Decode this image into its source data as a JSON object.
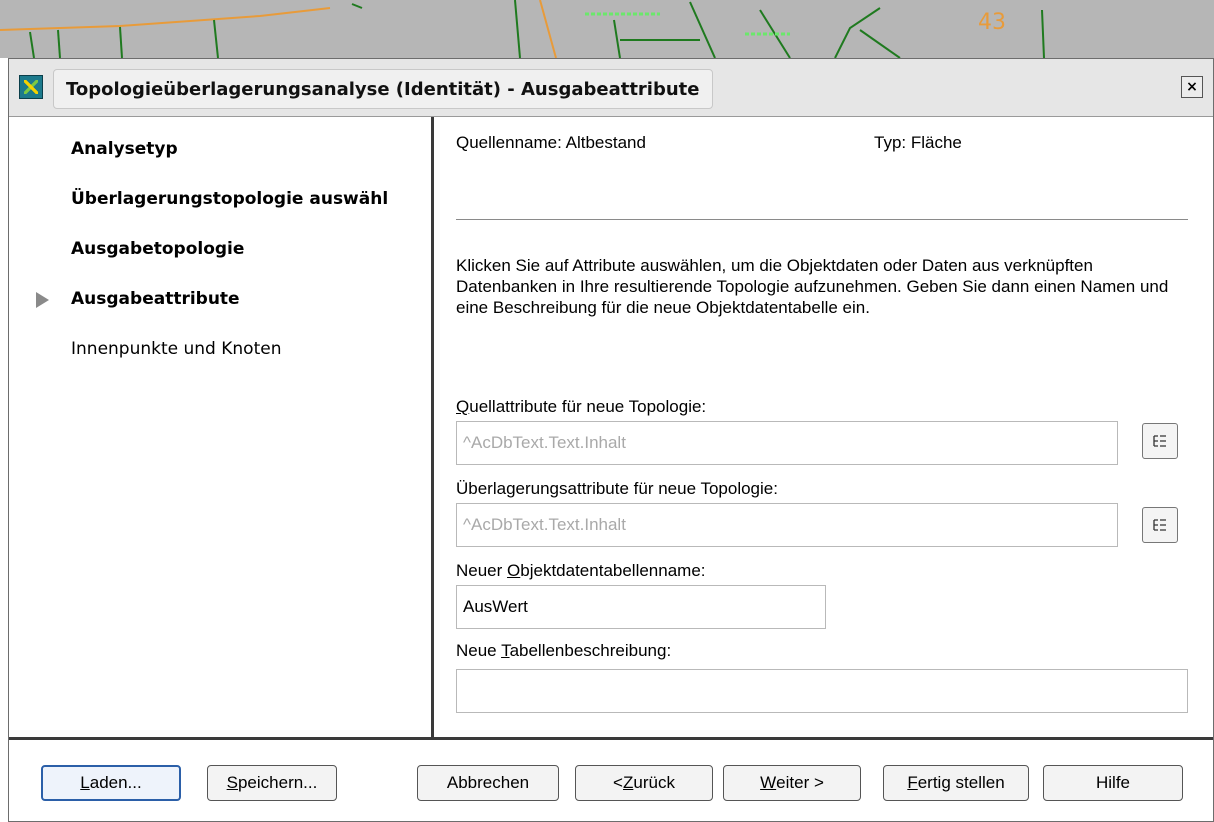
{
  "background_map": {
    "label": "43"
  },
  "dialog": {
    "title": "Topologieüberlagerungsanalyse (Identität) - Ausgabeattribute",
    "close_symbol": "×"
  },
  "nav": {
    "items": [
      {
        "label": "Analysetyp",
        "bold": true
      },
      {
        "label": "Überlagerungstopologie auswähl",
        "bold": true
      },
      {
        "label": "Ausgabetopologie",
        "bold": true
      },
      {
        "label": "Ausgabeattribute",
        "bold": true,
        "current": true
      },
      {
        "label": "Innenpunkte und Knoten",
        "bold": false
      }
    ]
  },
  "content": {
    "source_name": "Quellenname: Altbestand",
    "type": "Typ: Fläche",
    "instructions": "Klicken Sie auf Attribute auswählen, um die Objektdaten oder Daten aus verknüpften Datenbanken in Ihre resultierende Topologie aufzunehmen. Geben Sie dann einen Namen und eine Beschreibung für die neue Objektdatentabelle ein.",
    "source_attrs": {
      "label_key": "Q",
      "label_rest": "uellattribute für neue Topologie:",
      "value": "^AcDbText.Text.Inhalt"
    },
    "overlay_attrs": {
      "label": "Überlagerungsattribute für neue Topologie:",
      "value": "^AcDbText.Text.Inhalt"
    },
    "table_name": {
      "label_pre": "Neuer ",
      "label_key": "O",
      "label_rest": "bjektdatentabellenname:",
      "value": "AusWert"
    },
    "table_desc": {
      "label_pre": "Neue ",
      "label_key": "T",
      "label_rest": "abellenbeschreibung:",
      "value": ""
    }
  },
  "buttons": {
    "load": {
      "key": "L",
      "rest": "aden..."
    },
    "save": {
      "key": "S",
      "rest": "peichern..."
    },
    "cancel": "Abbrechen",
    "back": {
      "pre": "< ",
      "key": "Z",
      "rest": "urück"
    },
    "next": {
      "key": "W",
      "rest": "eiter >"
    },
    "finish": {
      "key": "F",
      "rest": "ertig stellen"
    },
    "help": "Hilfe"
  },
  "colors": {
    "default_button_border": "#2b5fa8",
    "map_background": "#b6b6b6",
    "map_line_orange": "#e89b3a",
    "map_line_green": "#1f7a1f"
  }
}
